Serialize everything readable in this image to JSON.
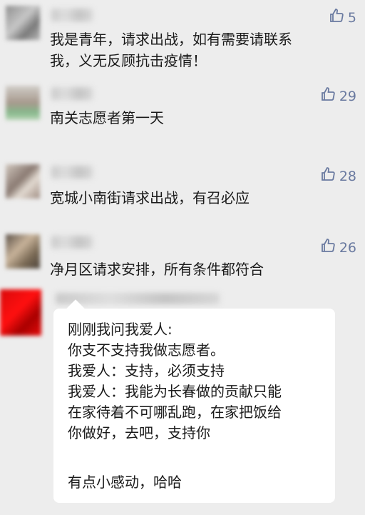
{
  "comments": [
    {
      "likes": "5",
      "text_lines": [
        "我是青年，请求出战，如有需要请联系",
        "我，义无反顾抗击疫情！"
      ]
    },
    {
      "likes": "29",
      "text_lines": [
        "南关志愿者第一天"
      ]
    },
    {
      "likes": "28",
      "text_lines": [
        "宽城小南街请求出战，有召必应"
      ]
    },
    {
      "likes": "26",
      "text_lines": [
        "净月区请求安排，所有条件都符合"
      ]
    }
  ],
  "reply_card": {
    "lines": [
      "刚刚我问我爱人:",
      "你支不支持我做志愿者。",
      "我爱人：支持，必须支持",
      "我爱人：我能为长春做的贡献只能",
      "在家待着不可哪乱跑，在家把饭给",
      "你做好，去吧，支持你",
      "有点小感动，哈哈"
    ]
  },
  "icons": {
    "like": "thumbs-up-icon"
  }
}
